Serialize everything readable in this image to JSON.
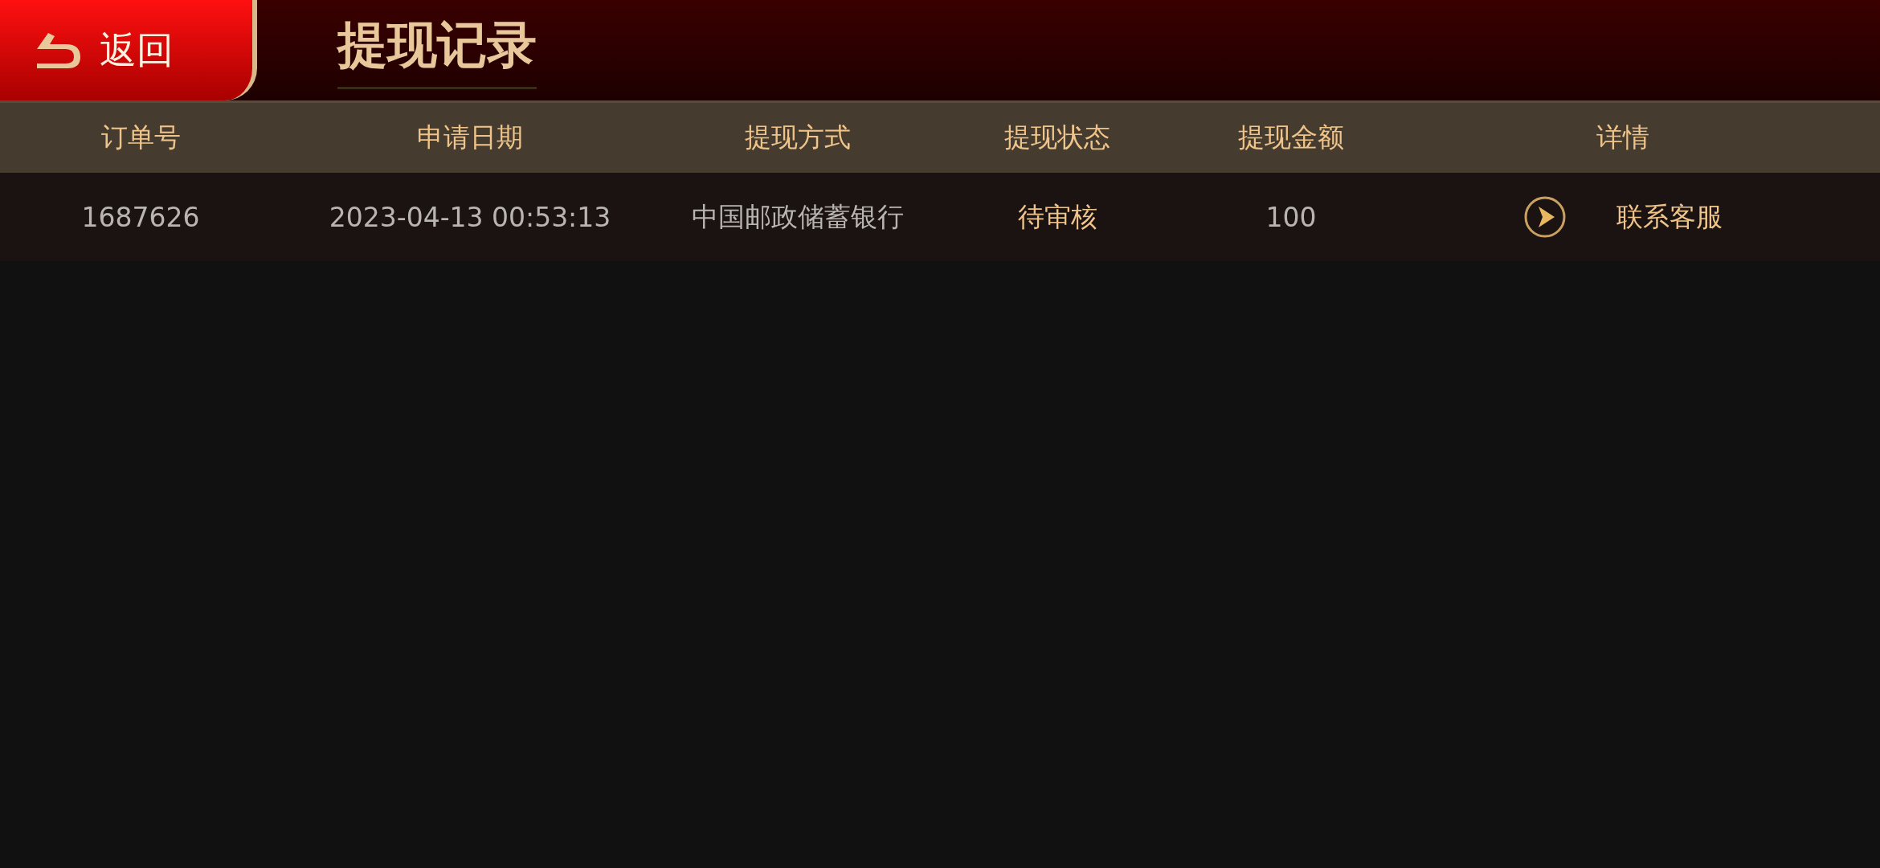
{
  "header": {
    "back_button": "返回",
    "title": "提现记录"
  },
  "table": {
    "columns": [
      "订单号",
      "申请日期",
      "提现方式",
      "提现状态",
      "提现金额",
      "详情"
    ],
    "rows": [
      {
        "order_no": "1687626",
        "date": "2023-04-13 00:53:13",
        "method": "中国邮政储蓄银行",
        "status": "待审核",
        "amount": "100",
        "detail": "联系客服"
      }
    ]
  }
}
